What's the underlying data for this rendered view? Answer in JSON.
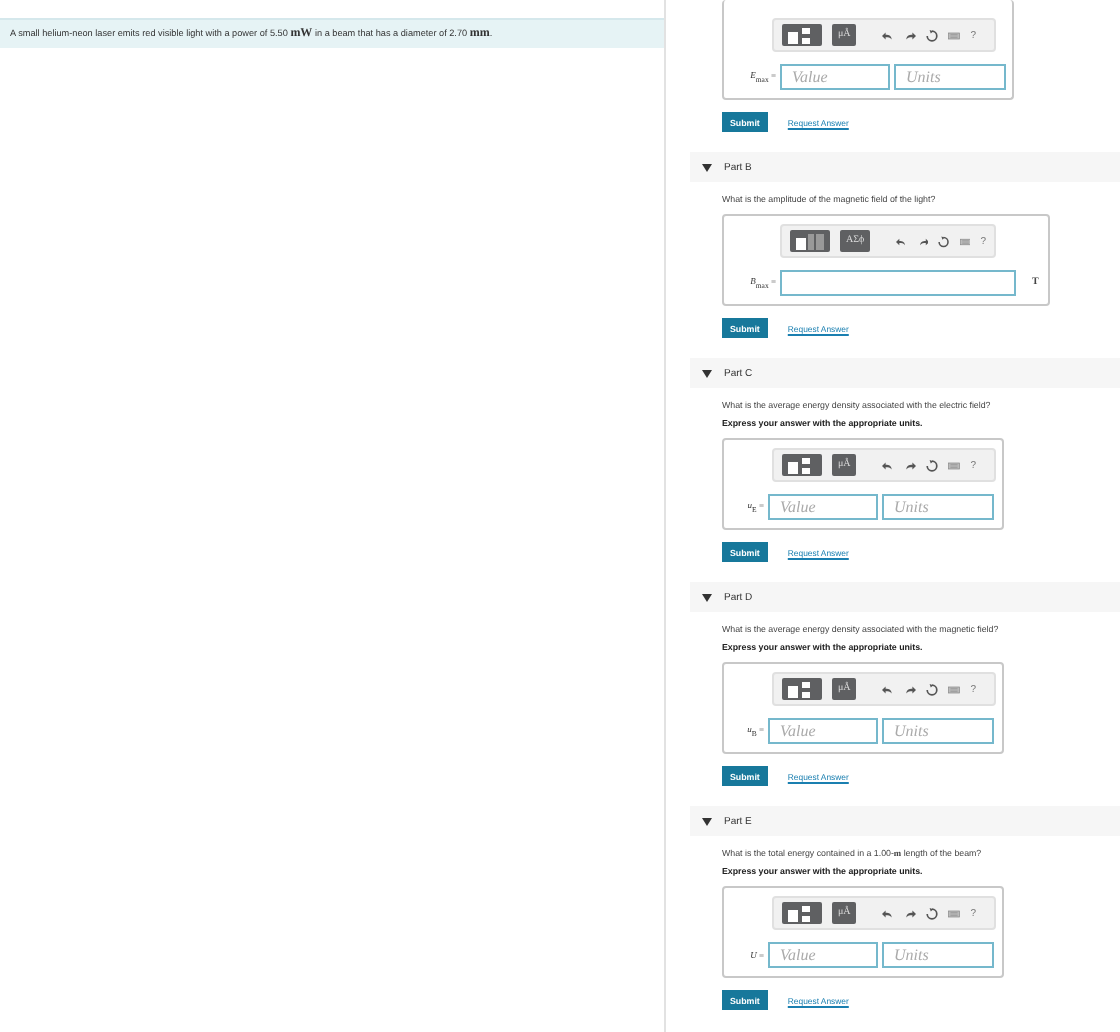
{
  "intro": "A small helium-neon laser emits red visible light with a power of 5.50 **mW** in a beam that has a diameter of 2.70 **mm**.",
  "parts": [
    {
      "kind": "units",
      "symbol_button": "μÅ",
      "help": "?",
      "label": "*E*$_{max}$ =",
      "value_placeholder": "Value",
      "units_placeholder": "Units",
      "submit": "Submit",
      "request": "Request Answer"
    },
    {
      "kind": "numeric",
      "title": "Part B",
      "expanded": true,
      "question": "What is the amplitude of the magnetic field of the light?",
      "symbol_button": "ΑΣϕ",
      "help": "?",
      "label": "*B*$_{max}$ =",
      "unit": "T",
      "submit": "Submit",
      "request": "Request Answer"
    },
    {
      "kind": "units",
      "title": "Part C",
      "expanded": true,
      "question": "What is the average energy density associated with the electric field?",
      "instruction": "Express your answer with the appropriate units.",
      "symbol_button": "μÅ",
      "help": "?",
      "label": "*u*$_{E}$ =",
      "value_placeholder": "Value",
      "units_placeholder": "Units",
      "submit": "Submit",
      "request": "Request Answer"
    },
    {
      "kind": "units",
      "title": "Part D",
      "expanded": true,
      "question": "What is the average energy density associated with the magnetic field?",
      "instruction": "Express your answer with the appropriate units.",
      "symbol_button": "μÅ",
      "help": "?",
      "label": "*u*$_{B}$ =",
      "value_placeholder": "Value",
      "units_placeholder": "Units",
      "submit": "Submit",
      "request": "Request Answer"
    },
    {
      "kind": "units",
      "title": "Part E",
      "expanded": true,
      "question": "What is the total energy contained in a 1.00-**m** length of the beam?",
      "instruction": "Express your answer with the appropriate units.",
      "symbol_button": "μÅ",
      "help": "?",
      "label": "*U* =",
      "value_placeholder": "Value",
      "units_placeholder": "Units",
      "submit": "Submit",
      "request": "Request Answer"
    }
  ]
}
